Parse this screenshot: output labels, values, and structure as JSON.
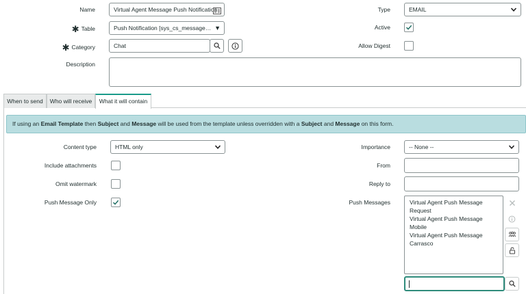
{
  "header_fields": {
    "name": {
      "label": "Name",
      "value": "Virtual Agent Message Push Notification"
    },
    "table": {
      "label": "Table",
      "value": "Push Notification [sys_cs_message_n..."
    },
    "category": {
      "label": "Category",
      "value": "Chat"
    },
    "description": {
      "label": "Description",
      "value": ""
    },
    "type": {
      "label": "Type",
      "value": "EMAIL"
    },
    "active": {
      "label": "Active",
      "checked": true
    },
    "allow_digest": {
      "label": "Allow Digest",
      "checked": false
    }
  },
  "tabs": [
    {
      "label": "When to send",
      "active": false
    },
    {
      "label": "Who will receive",
      "active": false
    },
    {
      "label": "What it will contain",
      "active": true
    }
  ],
  "info_message": {
    "p1": "If using an ",
    "b1": "Email Template",
    "p2": " then ",
    "b2": "Subject",
    "p3": " and ",
    "b3": "Message",
    "p4": " will be used from the template unless overridden with a ",
    "b4": "Subject",
    "p5": " and ",
    "b5": "Message",
    "p6": " on this form."
  },
  "content": {
    "content_type": {
      "label": "Content type",
      "value": "HTML only"
    },
    "include_attachments": {
      "label": "Include attachments",
      "checked": false
    },
    "omit_watermark": {
      "label": "Omit watermark",
      "checked": false
    },
    "push_message_only": {
      "label": "Push Message Only",
      "checked": true
    },
    "importance": {
      "label": "Importance",
      "value": "-- None --"
    },
    "from": {
      "label": "From",
      "value": ""
    },
    "reply_to": {
      "label": "Reply to",
      "value": ""
    },
    "push_messages": {
      "label": "Push Messages",
      "items": [
        "Virtual Agent Push Message Request",
        "Virtual Agent Push Message Mobile",
        "Virtual Agent Push Message Carrasco"
      ],
      "search_value": ""
    }
  },
  "colors": {
    "accent": "#1a9b8a",
    "info_bg": "#b9dde0",
    "border": "#8a9394"
  }
}
